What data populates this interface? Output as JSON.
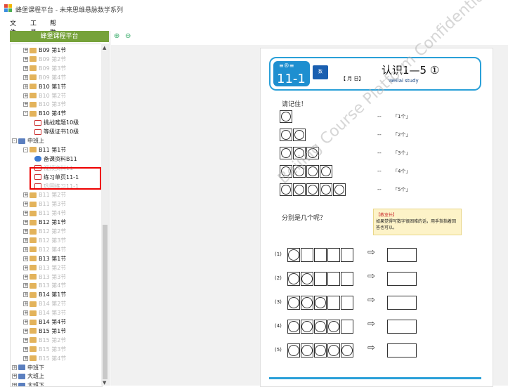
{
  "window": {
    "title": "蜂堡课程平台 - 未来思维悬脉数学系列"
  },
  "menu": [
    "文件",
    "工具",
    "帮助"
  ],
  "sidebar": {
    "platform_button": "蜂堡课程平台",
    "tree": [
      {
        "label": "B09 第1节",
        "type": "folder",
        "expander": "+",
        "faded": false
      },
      {
        "label": "B09 第2节",
        "type": "folder",
        "expander": "+",
        "faded": true
      },
      {
        "label": "B09 第3节",
        "type": "folder",
        "expander": "+",
        "faded": true
      },
      {
        "label": "B09 第4节",
        "type": "folder",
        "expander": "+",
        "faded": true
      },
      {
        "label": "B10 第1节",
        "type": "folder",
        "expander": "+",
        "faded": false
      },
      {
        "label": "B10 第2节",
        "type": "folder",
        "expander": "+",
        "faded": true
      },
      {
        "label": "B10 第3节",
        "type": "folder",
        "expander": "+",
        "faded": true
      },
      {
        "label": "B10 第4节",
        "type": "folder",
        "expander": "-",
        "faded": false
      },
      {
        "label": "挑战难题10级",
        "type": "doc",
        "expander": "",
        "faded": false
      },
      {
        "label": "等级证书10级",
        "type": "doc",
        "expander": "",
        "faded": false
      },
      {
        "label": "中班上",
        "type": "group",
        "expander": "-",
        "faded": false
      },
      {
        "label": "B11 第1节",
        "type": "folder",
        "expander": "-",
        "faded": false
      },
      {
        "label": "备课资料B11",
        "type": "globe",
        "expander": "",
        "faded": false
      },
      {
        "label": "视频资料11",
        "type": "doc",
        "expander": "",
        "faded": true
      },
      {
        "label": "练习单页11-1",
        "type": "doc",
        "expander": "",
        "faded": false
      },
      {
        "label": "巩固练习11-1",
        "type": "doc",
        "expander": "",
        "faded": true
      },
      {
        "label": "B11 第2节",
        "type": "folder",
        "expander": "+",
        "faded": true
      },
      {
        "label": "B11 第3节",
        "type": "folder",
        "expander": "+",
        "faded": true
      },
      {
        "label": "B11 第4节",
        "type": "folder",
        "expander": "+",
        "faded": true
      },
      {
        "label": "B12 第1节",
        "type": "folder",
        "expander": "+",
        "faded": false
      },
      {
        "label": "B12 第2节",
        "type": "folder",
        "expander": "+",
        "faded": true
      },
      {
        "label": "B12 第3节",
        "type": "folder",
        "expander": "+",
        "faded": true
      },
      {
        "label": "B12 第4节",
        "type": "folder",
        "expander": "+",
        "faded": true
      },
      {
        "label": "B13 第1节",
        "type": "folder",
        "expander": "+",
        "faded": false
      },
      {
        "label": "B13 第2节",
        "type": "folder",
        "expander": "+",
        "faded": true
      },
      {
        "label": "B13 第3节",
        "type": "folder",
        "expander": "+",
        "faded": true
      },
      {
        "label": "B13 第4节",
        "type": "folder",
        "expander": "+",
        "faded": true
      },
      {
        "label": "B14 第1节",
        "type": "folder",
        "expander": "+",
        "faded": false
      },
      {
        "label": "B14 第2节",
        "type": "folder",
        "expander": "+",
        "faded": true
      },
      {
        "label": "B14 第3节",
        "type": "folder",
        "expander": "+",
        "faded": true
      },
      {
        "label": "B14 第4节",
        "type": "folder",
        "expander": "+",
        "faded": false
      },
      {
        "label": "B15 第1节",
        "type": "folder",
        "expander": "+",
        "faded": false
      },
      {
        "label": "B15 第2节",
        "type": "folder",
        "expander": "+",
        "faded": true
      },
      {
        "label": "B15 第3节",
        "type": "folder",
        "expander": "+",
        "faded": true
      },
      {
        "label": "B15 第4节",
        "type": "folder",
        "expander": "+",
        "faded": true
      },
      {
        "label": "中班下",
        "type": "group",
        "expander": "+",
        "faded": false
      },
      {
        "label": "大班上",
        "type": "group",
        "expander": "+",
        "faded": false
      },
      {
        "label": "大班下",
        "type": "group",
        "expander": "+",
        "faded": false
      }
    ]
  },
  "toolbar": {
    "zoom_in_icon": "⊕",
    "zoom_out_icon": "⊖"
  },
  "document": {
    "tab_logo": "≡®≡",
    "lesson_number": "11-1",
    "mini_tab": "数",
    "date_line": "【   月   日】",
    "title": "认识1—5 ①",
    "brand": "Weilai study",
    "remember": "请记住！",
    "counts": [
      "「1个」",
      "「2个」",
      "「3个」",
      "「4个」",
      "「5个」"
    ],
    "dash": "--",
    "question": "分别是几个呢？",
    "tip_title": "【教室长】",
    "tip_text": "如果觉得写数字很困难的话，用手指指着回答也可以。",
    "exercises": [
      "(1)",
      "(2)",
      "(3)",
      "(4)",
      "(5)"
    ],
    "arrow": "⇨",
    "watermark": "Beijing Course Platform Confidential"
  }
}
